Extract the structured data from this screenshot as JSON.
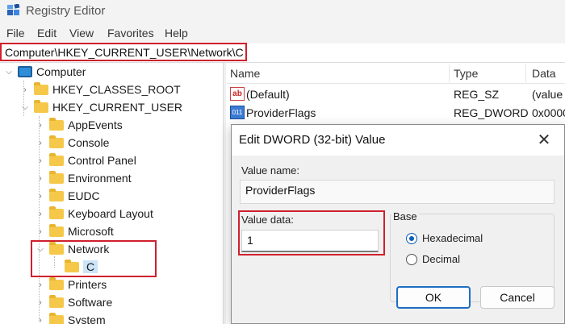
{
  "window": {
    "title": "Registry Editor"
  },
  "menu": [
    "File",
    "Edit",
    "View",
    "Favorites",
    "Help"
  ],
  "address": {
    "path": "Computer\\HKEY_CURRENT_USER\\Network\\C"
  },
  "tree": {
    "root": "Computer",
    "hives": [
      "HKEY_CLASSES_ROOT",
      "HKEY_CURRENT_USER"
    ],
    "hkcu_children": [
      "AppEvents",
      "Console",
      "Control Panel",
      "Environment",
      "EUDC",
      "Keyboard Layout",
      "Microsoft",
      "Network",
      "Printers",
      "Software",
      "System"
    ],
    "network_child": "C"
  },
  "list": {
    "columns": [
      "Name",
      "Type",
      "Data"
    ],
    "rows": [
      {
        "name": "(Default)",
        "type": "REG_SZ",
        "data": "(value",
        "icon": "string-value-icon"
      },
      {
        "name": "ProviderFlags",
        "type": "REG_DWORD",
        "data": "0x0000",
        "icon": "binary-value-icon"
      }
    ]
  },
  "dialog": {
    "title": "Edit DWORD (32-bit) Value",
    "close_glyph": "✕",
    "value_name_label": "Value name:",
    "value_name": "ProviderFlags",
    "value_data_label": "Value data:",
    "value_data": "1",
    "base_label": "Base",
    "base_options": [
      "Hexadecimal",
      "Decimal"
    ],
    "base_selected": "Hexadecimal",
    "ok_label": "OK",
    "cancel_label": "Cancel"
  },
  "colors": {
    "highlight": "#d0202c",
    "accent": "#0b5fb5",
    "selection": "#cce4f7"
  }
}
